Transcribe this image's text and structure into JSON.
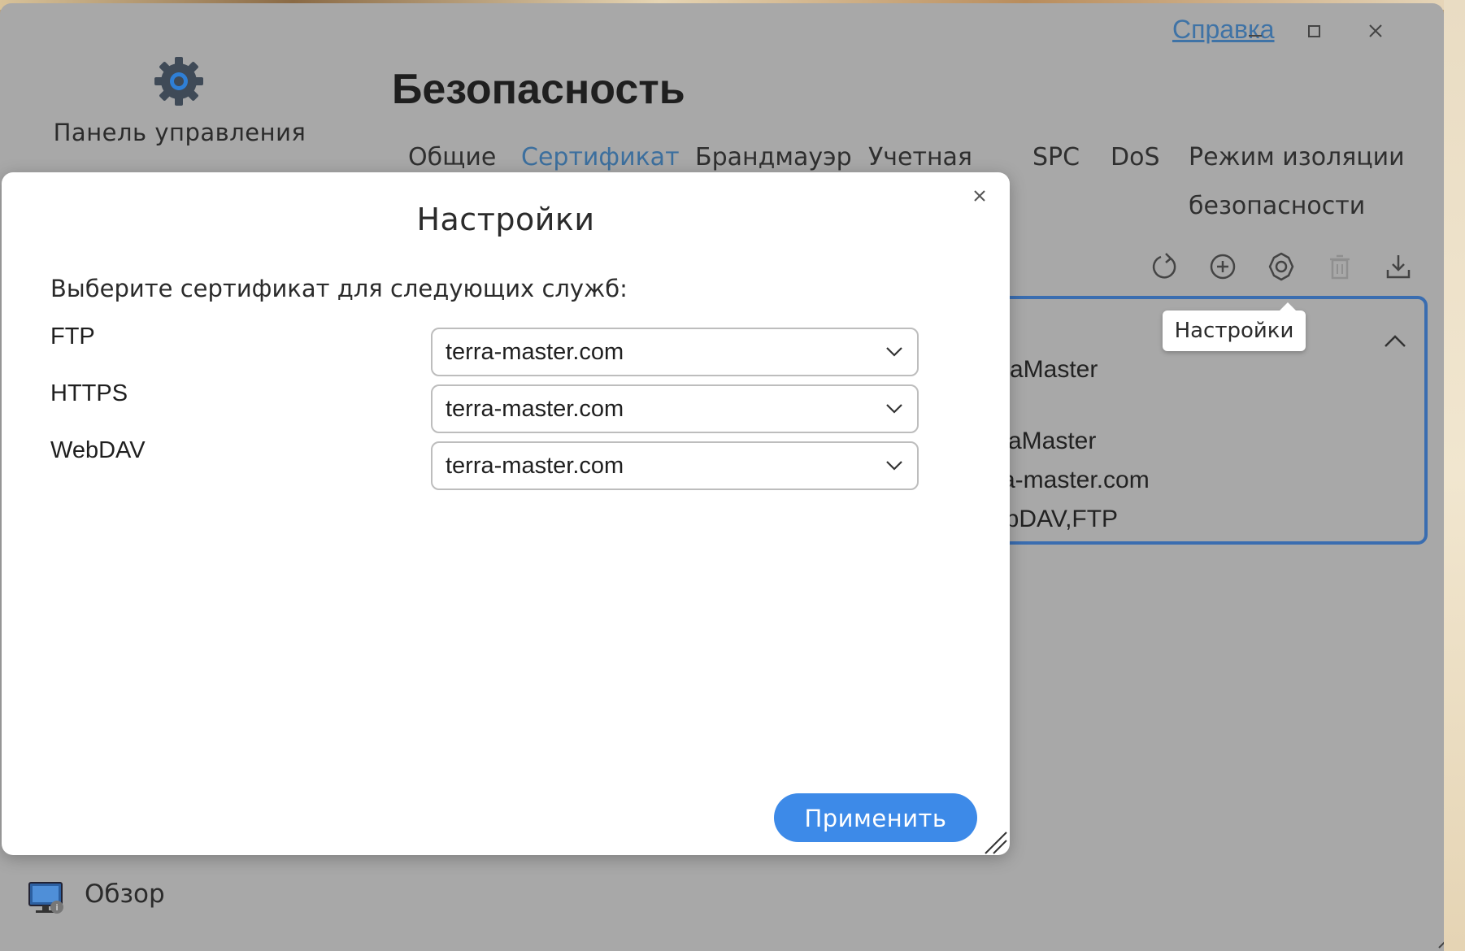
{
  "window": {
    "help_link": "Справка",
    "minimize_icon": "minimize-icon",
    "maximize_icon": "maximize-icon",
    "close_icon": "close-icon"
  },
  "sidebar": {
    "app_title": "Панель управления",
    "app_icon": "gear-icon",
    "items": [
      {
        "label": "Обзор",
        "icon": "monitor-info-icon"
      }
    ]
  },
  "header": {
    "title": "Безопасность",
    "tabs": [
      {
        "label": "Общие",
        "active": false
      },
      {
        "label": "Сертификат",
        "active": true
      },
      {
        "label": "Брандмауэр",
        "active": false
      },
      {
        "label": "Учетная",
        "active": false
      },
      {
        "label": "SPC",
        "active": false
      },
      {
        "label": "DoS",
        "active": false
      },
      {
        "label": "Режим изоляции безопасности",
        "line1": "Режим изоляции",
        "line2": "безопасности",
        "active": false
      }
    ]
  },
  "toolbar": {
    "icons": [
      "refresh-icon",
      "add-icon",
      "settings-icon",
      "delete-icon",
      "download-icon"
    ],
    "tooltip": "Настройки"
  },
  "certificate_card": {
    "lines": [
      "raMaster",
      "rraMaster",
      "ra-master.com",
      "ebDAV,FTP"
    ]
  },
  "dialog": {
    "title": "Настройки",
    "prompt": "Выберите сертификат для следующих служб:",
    "services": [
      {
        "name": "FTP",
        "certificate": "terra-master.com"
      },
      {
        "name": "HTTPS",
        "certificate": "terra-master.com"
      },
      {
        "name": "WebDAV",
        "certificate": "terra-master.com"
      }
    ],
    "apply_label": "Применить"
  },
  "colors": {
    "accent": "#3d8ae8",
    "active_tab": "#3c6f9e",
    "card_border": "#3a6db0",
    "window_overlay": "#a8a8a8"
  }
}
